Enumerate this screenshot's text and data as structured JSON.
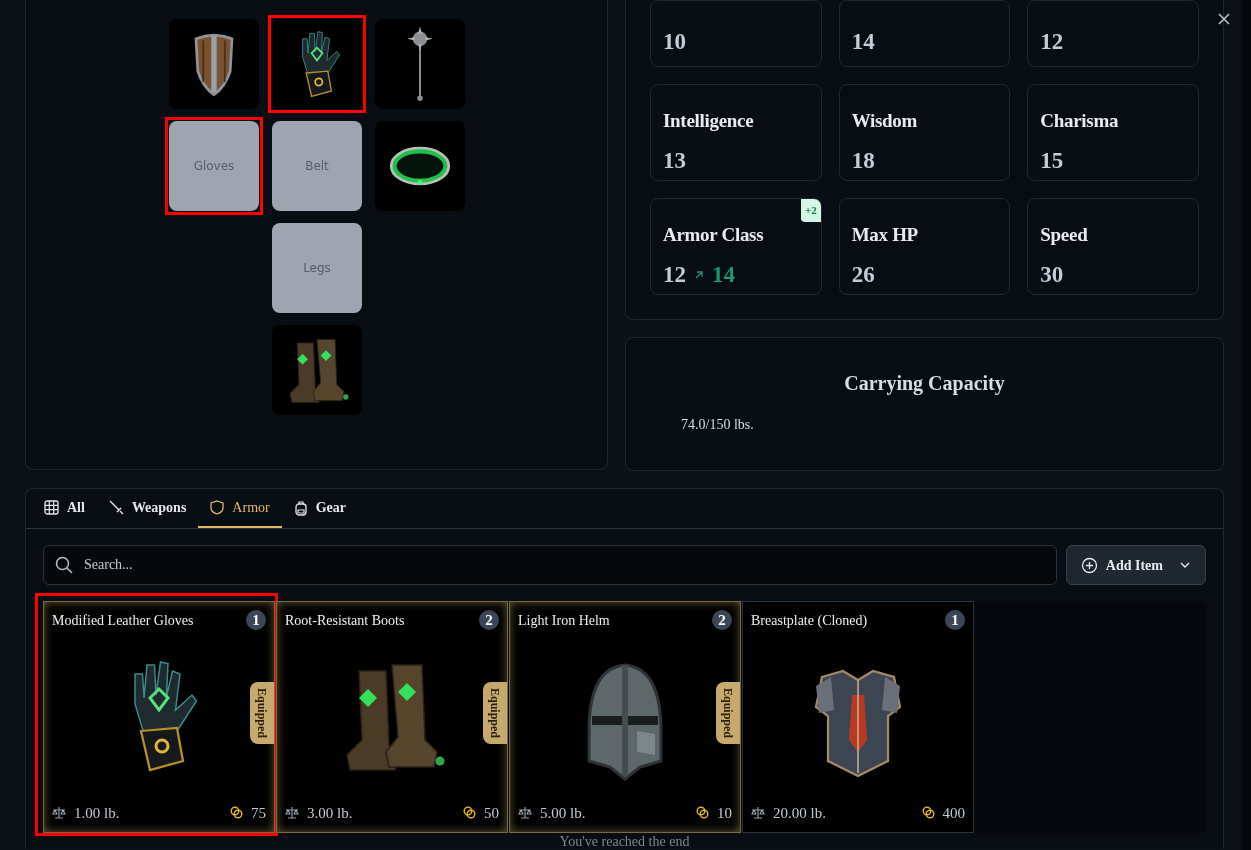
{
  "equipment_slots": [
    {
      "kind": "picture",
      "highlighted": false
    },
    {
      "kind": "picture",
      "highlighted": true
    },
    {
      "kind": "picture",
      "highlighted": false
    },
    {
      "kind": "empty",
      "label": "Gloves",
      "highlighted": true
    },
    {
      "kind": "empty",
      "label": "Belt",
      "highlighted": false
    },
    {
      "kind": "picture",
      "highlighted": false
    },
    {
      "kind": "vacant"
    },
    {
      "kind": "empty",
      "label": "Legs",
      "highlighted": false
    },
    {
      "kind": "vacant"
    },
    {
      "kind": "vacant"
    },
    {
      "kind": "picture",
      "highlighted": false
    },
    {
      "kind": "vacant"
    }
  ],
  "stats": [
    {
      "value": "10"
    },
    {
      "value": "14"
    },
    {
      "value": "12"
    },
    {
      "label": "Intelligence",
      "value": "13"
    },
    {
      "label": "Wisdom",
      "value": "18"
    },
    {
      "label": "Charisma",
      "value": "15"
    },
    {
      "label": "Armor Class",
      "value": "12",
      "new_value": "14",
      "bonus": "+2"
    },
    {
      "label": "Max HP",
      "value": "26"
    },
    {
      "label": "Speed",
      "value": "30"
    }
  ],
  "carrying_capacity": {
    "title": "Carrying Capacity",
    "reading": "74.0/150 lbs."
  },
  "tabs": [
    {
      "label": "All",
      "selected": false
    },
    {
      "label": "Weapons",
      "selected": false
    },
    {
      "label": "Armor",
      "selected": true
    },
    {
      "label": "Gear",
      "selected": false
    }
  ],
  "search": {
    "placeholder": "Search..."
  },
  "add_button": {
    "label": "Add Item"
  },
  "items": [
    {
      "name": "Modified Leather Gloves",
      "count": "1",
      "equipped": true,
      "equipped_label": "Equipped",
      "weight": "1.00 lb.",
      "price": "75",
      "highlighted": true
    },
    {
      "name": "Root-Resistant Boots",
      "count": "2",
      "equipped": true,
      "equipped_label": "Equipped",
      "weight": "3.00 lb.",
      "price": "50",
      "highlighted": false
    },
    {
      "name": "Light Iron Helm",
      "count": "2",
      "equipped": true,
      "equipped_label": "Equipped",
      "weight": "5.00 lb.",
      "price": "10",
      "highlighted": false
    },
    {
      "name": "Breastplate (Cloned)",
      "count": "1",
      "equipped": false,
      "weight": "20.00 lb.",
      "price": "400",
      "highlighted": false
    }
  ],
  "end_message": "You've reached the end"
}
